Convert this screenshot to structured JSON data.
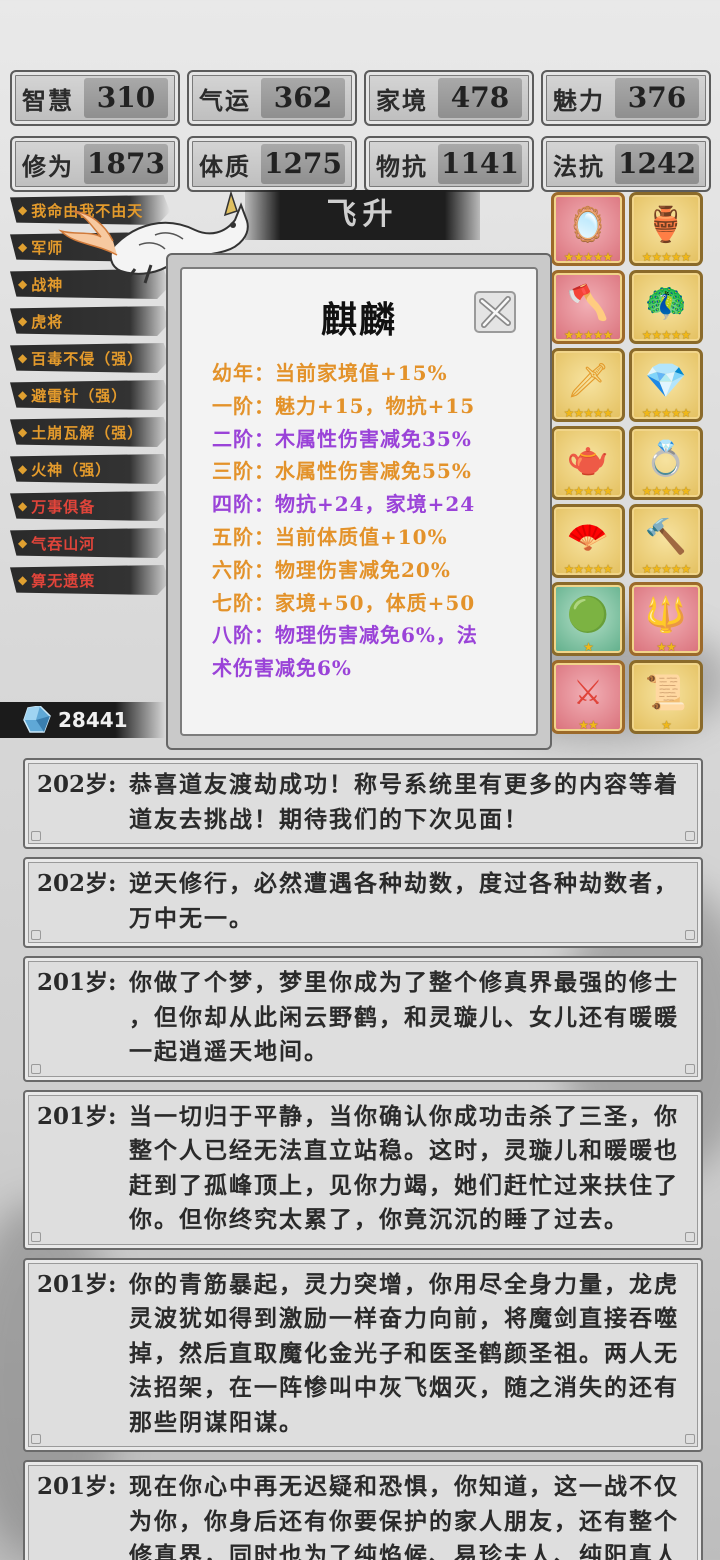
{
  "stats": [
    {
      "key": "智慧",
      "value": "310"
    },
    {
      "key": "气运",
      "value": "362"
    },
    {
      "key": "家境",
      "value": "478"
    },
    {
      "key": "魅力",
      "value": "376"
    },
    {
      "key": "修为",
      "value": "1873"
    },
    {
      "key": "体质",
      "value": "1275"
    },
    {
      "key": "物抗",
      "value": "1141"
    },
    {
      "key": "法抗",
      "value": "1242"
    }
  ],
  "banner": "飞升",
  "titles": [
    {
      "label": "我命由我不由天",
      "color": "gold"
    },
    {
      "label": "军师",
      "color": "gold"
    },
    {
      "label": "战神",
      "color": "gold"
    },
    {
      "label": "虎将",
      "color": "gold"
    },
    {
      "label": "百毒不侵（强）",
      "color": "gold"
    },
    {
      "label": "避雷针（强）",
      "color": "gold"
    },
    {
      "label": "土崩瓦解（强）",
      "color": "gold"
    },
    {
      "label": "火神（强）",
      "color": "gold"
    },
    {
      "label": "万事俱备",
      "color": "red"
    },
    {
      "label": "气吞山河",
      "color": "red"
    },
    {
      "label": "算无遗策",
      "color": "red"
    }
  ],
  "gems": "28441",
  "equipment": [
    {
      "icon": "mirror-icon",
      "glyph": "🪞",
      "bg": "red",
      "stars": "★★★★★"
    },
    {
      "icon": "cauldron-icon",
      "glyph": "🏺",
      "bg": "gold",
      "stars": "★★★★★"
    },
    {
      "icon": "axe-icon",
      "glyph": "🪓",
      "bg": "red",
      "stars": "★★★★★"
    },
    {
      "icon": "phoenix-icon",
      "glyph": "🦚",
      "bg": "gold",
      "stars": "★★★★★"
    },
    {
      "icon": "sword-icon",
      "glyph": "🗡",
      "bg": "gold",
      "stars": "★★★★★"
    },
    {
      "icon": "crystal-icon",
      "glyph": "💎",
      "bg": "gold",
      "stars": "★★★★★"
    },
    {
      "icon": "teapot-icon",
      "glyph": "🫖",
      "bg": "gold",
      "stars": "★★★★★"
    },
    {
      "icon": "ring-icon",
      "glyph": "💍",
      "bg": "gold",
      "stars": "★★★★★"
    },
    {
      "icon": "fan-icon",
      "glyph": "🪭",
      "bg": "gold",
      "stars": "★★★★★"
    },
    {
      "icon": "mace-icon",
      "glyph": "🔨",
      "bg": "gold",
      "stars": "★★★★★"
    },
    {
      "icon": "orb-icon",
      "glyph": "🟢",
      "bg": "green",
      "stars": "★"
    },
    {
      "icon": "spear-icon",
      "glyph": "🔱",
      "bg": "red",
      "stars": "★★"
    },
    {
      "icon": "blade-icon",
      "glyph": "⚔",
      "bg": "red",
      "stars": "★★"
    },
    {
      "icon": "scroll-icon",
      "glyph": "📜",
      "bg": "gold",
      "stars": "★"
    }
  ],
  "popup": {
    "title": "麒麟",
    "stages": [
      {
        "text": "幼年：当前家境值+15%",
        "color": "o"
      },
      {
        "text": "一阶：魅力+15，物抗+15",
        "color": "o"
      },
      {
        "text": "二阶：木属性伤害减免35%",
        "color": "p"
      },
      {
        "text": "三阶：水属性伤害减免55%",
        "color": "o"
      },
      {
        "text": "四阶：物抗+24，家境+24",
        "color": "p"
      },
      {
        "text": "五阶：当前体质值+10%",
        "color": "o"
      },
      {
        "text": "六阶：物理伤害减免20%",
        "color": "o"
      },
      {
        "text": "七阶：家境+50，体质+50",
        "color": "o"
      },
      {
        "text": "八阶：物理伤害减免6%，法",
        "color": "p"
      },
      {
        "text": "术伤害减免6%",
        "color": "p"
      }
    ]
  },
  "logs": [
    {
      "age": "202岁:",
      "lines": [
        "恭喜道友渡劫成功！称号系统里有更多的内容等着",
        "道友去挑战！期待我们的下次见面！"
      ]
    },
    {
      "age": "202岁:",
      "lines": [
        "逆天修行，必然遭遇各种劫数，度过各种劫数者，",
        "万中无一。"
      ]
    },
    {
      "age": "201岁:",
      "lines": [
        "你做了个梦，梦里你成为了整个修真界最强的修士",
        "，但你却从此闲云野鹤，和灵璇儿、女儿还有暖暖",
        "一起逍遥天地间。"
      ]
    },
    {
      "age": "201岁:",
      "lines": [
        "当一切归于平静，当你确认你成功击杀了三圣，你",
        "整个人已经无法直立站稳。这时，灵璇儿和暖暖也",
        "赶到了孤峰顶上，见你力竭，她们赶忙过来扶住了",
        "你。但你终究太累了，你竟沉沉的睡了过去。"
      ]
    },
    {
      "age": "201岁:",
      "lines": [
        "你的青筋暴起，灵力突增，你用尽全身力量，龙虎",
        "灵波犹如得到激励一样奋力向前，将魔剑直接吞噬",
        "掉，然后直取魔化金光子和医圣鹤颜圣祖。两人无",
        "法招架，在一阵惨叫中灰飞烟灭，随之消失的还有",
        "那些阴谋阳谋。"
      ]
    },
    {
      "age": "201岁:",
      "lines": [
        "现在你心中再无迟疑和恐惧，你知道，这一战不仅",
        "为你，你身后还有你要保护的家人朋友，还有整个",
        "修真界，同时也为了纯焰候、易珍夫人、纯阳真人"
      ]
    }
  ]
}
